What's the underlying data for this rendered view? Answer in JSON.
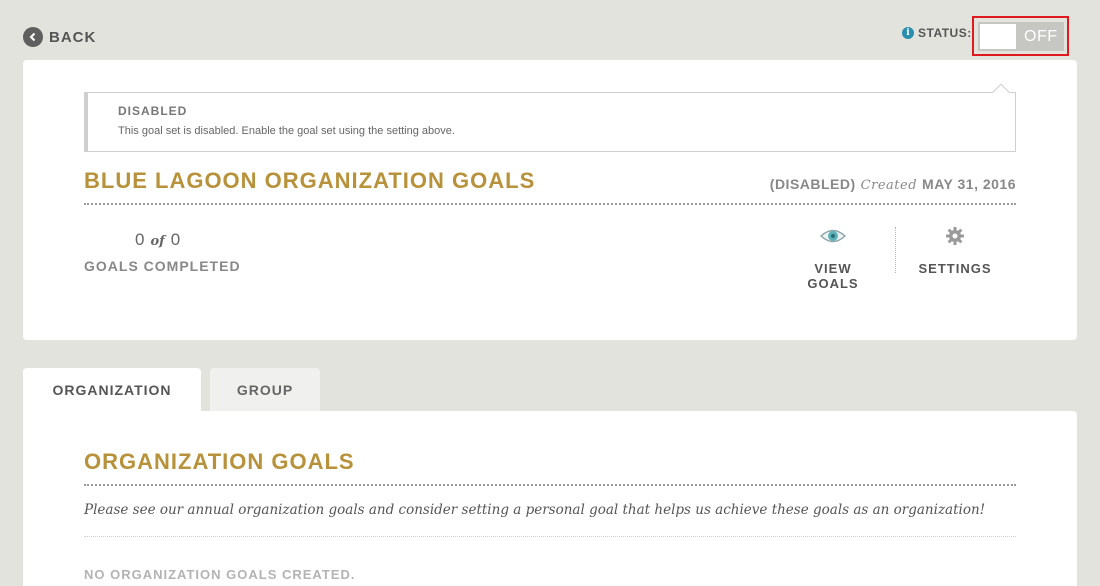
{
  "header": {
    "back_label": "BACK",
    "status_label": "STATUS:",
    "toggle_state": "OFF"
  },
  "notice": {
    "title": "DISABLED",
    "text": "This goal set is disabled. Enable the goal set using the setting above."
  },
  "goal_set": {
    "title": "BLUE LAGOON ORGANIZATION GOALS",
    "state": "(DISABLED)",
    "created_label": "Created",
    "created_date": "MAY 31, 2016",
    "completed": "0",
    "of_label": "of",
    "total": "0",
    "completed_label": "GOALS COMPLETED",
    "actions": {
      "view_goals": "VIEW GOALS",
      "settings": "SETTINGS"
    }
  },
  "tabs": [
    {
      "label": "ORGANIZATION"
    },
    {
      "label": "GROUP"
    }
  ],
  "panel": {
    "title": "ORGANIZATION GOALS",
    "description": "Please see our annual organization goals and consider setting a personal goal that helps us achieve these goals as an organization!",
    "empty": "NO ORGANIZATION GOALS CREATED."
  },
  "colors": {
    "accent_gold": "#b8923a",
    "info_blue": "#2a8fae",
    "highlight_red": "#e0191f",
    "background": "#e3e3de"
  }
}
